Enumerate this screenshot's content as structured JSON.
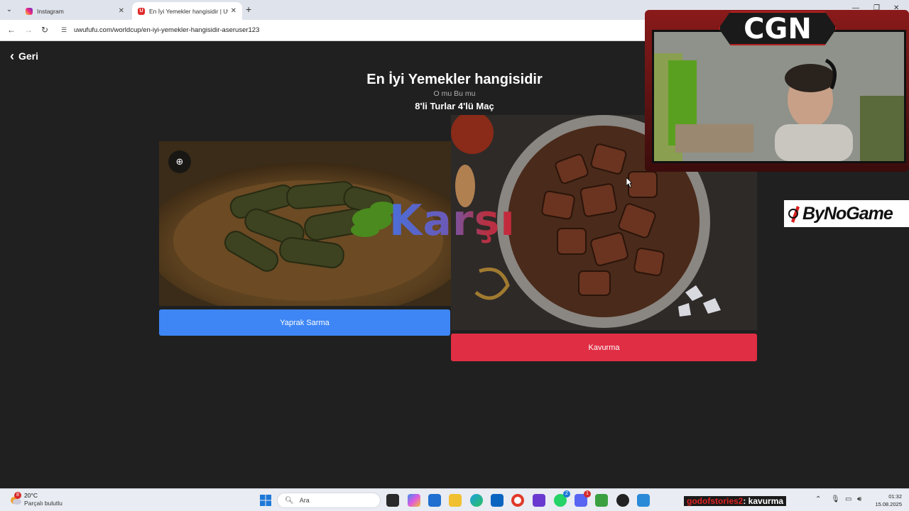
{
  "browser": {
    "tabs": [
      {
        "title": "Instagram",
        "active": false,
        "favicon": "instagram-icon"
      },
      {
        "title": "En İyi Yemekler hangisidir | Uw...",
        "active": true,
        "favicon": "uwufufu-icon"
      }
    ],
    "url": "uwufufu.com/worldcup/en-iyi-yemekler-hangisidir-aseruser123"
  },
  "page": {
    "back_label": "Geri",
    "title": "En İyi Yemekler hangisidir",
    "subtitle": "O mu Bu mu",
    "round": "8'li Turlar 4'lü Maç",
    "versus": "Karşı",
    "choices": [
      {
        "label": "Yaprak Sarma",
        "color": "#3e86f5"
      },
      {
        "label": "Kavurma",
        "color": "#e02e44"
      }
    ]
  },
  "overlay": {
    "cam_logo": "CGN",
    "sponsor": "ByNoGame"
  },
  "taskbar": {
    "weather_temp": "20°C",
    "weather_condition": "Parçalı bulutlu",
    "weather_badge": "8",
    "search_placeholder": "Ara",
    "chat_user": "godofstories2",
    "chat_message": ": kavurma",
    "clock_time": "01:32",
    "clock_date": "15.08.2025",
    "badges": {
      "whatsapp": "2",
      "discord": "1"
    }
  },
  "colors": {
    "background": "#202020",
    "blue": "#3e86f5",
    "red": "#e02e44"
  }
}
